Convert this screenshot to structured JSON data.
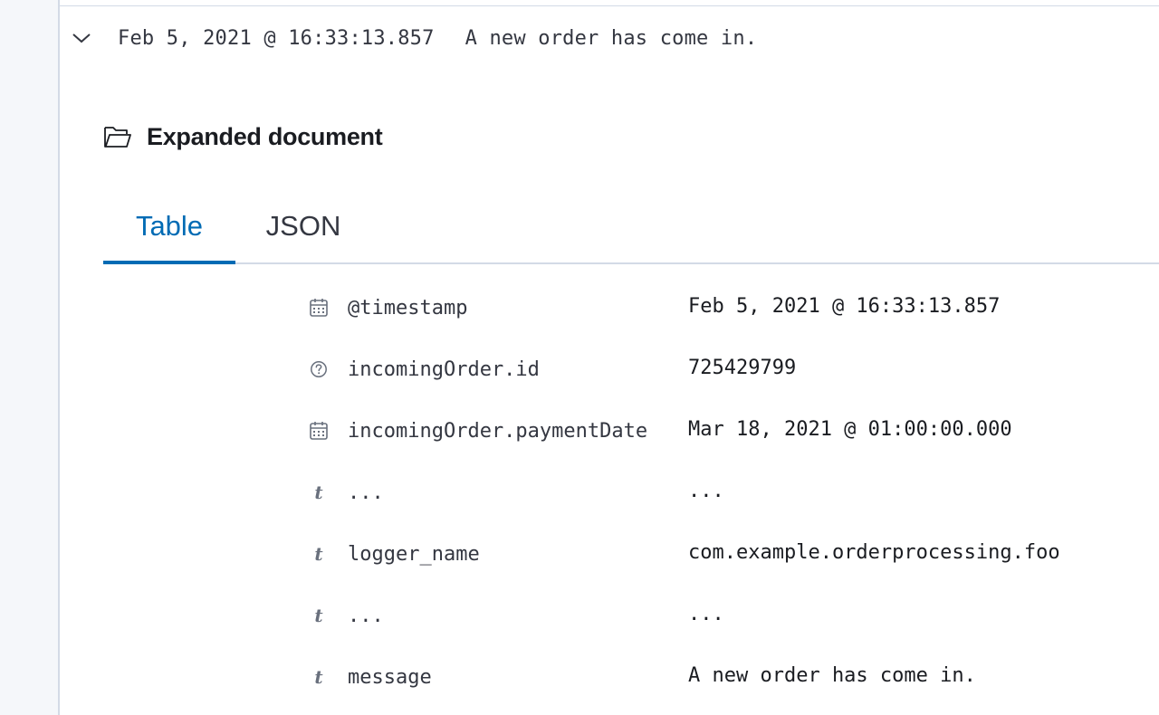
{
  "document_row": {
    "timestamp": "Feb 5, 2021 @ 16:33:13.857",
    "message": "A new order has come in."
  },
  "expanded": {
    "title": "Expanded document",
    "tabs": [
      {
        "label": "Table",
        "active": true
      },
      {
        "label": "JSON",
        "active": false
      }
    ]
  },
  "fields": [
    {
      "type": "date",
      "name": "@timestamp",
      "value": "Feb 5, 2021 @ 16:33:13.857"
    },
    {
      "type": "unknown",
      "name": "incomingOrder.id",
      "value": "725429799"
    },
    {
      "type": "date",
      "name": "incomingOrder.paymentDate",
      "value": "Mar 18, 2021 @ 01:00:00.000"
    },
    {
      "type": "string",
      "name": "...",
      "value": "..."
    },
    {
      "type": "string",
      "name": "logger_name",
      "value": "com.example.orderprocessing.foo"
    },
    {
      "type": "string",
      "name": "...",
      "value": "..."
    },
    {
      "type": "string",
      "name": "message",
      "value": "A new order has come in."
    }
  ],
  "icons": {
    "chevron": "chevron-down-icon",
    "folder": "folder-open-icon",
    "date": "calendar-icon",
    "unknown": "question-circle-icon",
    "string": "text-type-icon"
  },
  "string_type_glyph": "t",
  "colors": {
    "accent": "#006bb4",
    "text": "#343741",
    "muted": "#69707d",
    "border": "#d3dae6",
    "gutter": "#f5f7fa"
  }
}
